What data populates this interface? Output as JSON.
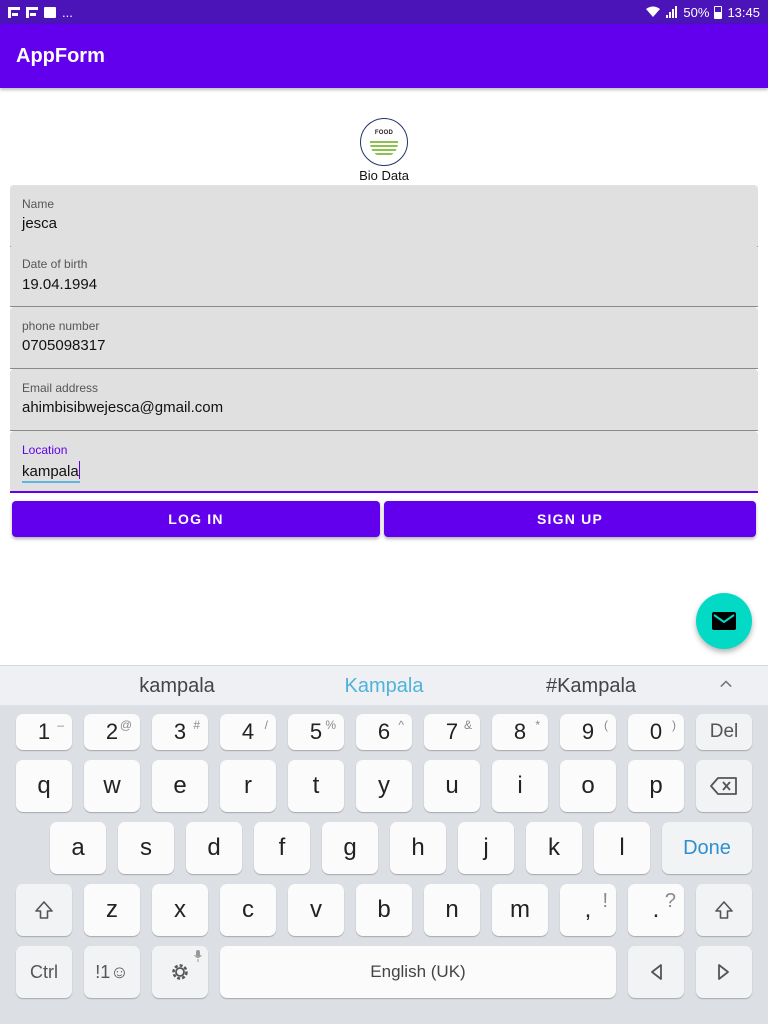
{
  "status_bar": {
    "notif_more": "...",
    "battery_percent": "50%",
    "time": "13:45"
  },
  "appbar": {
    "title": "AppForm"
  },
  "logo": {
    "text": "FOOD"
  },
  "form": {
    "title": "Bio Data",
    "fields": [
      {
        "label": "Name",
        "value": "jesca"
      },
      {
        "label": "Date of birth",
        "value": "19.04.1994"
      },
      {
        "label": "phone number",
        "value": "0705098317"
      },
      {
        "label": "Email address",
        "value": "ahimbisibwejesca@gmail.com"
      },
      {
        "label": "Location",
        "value": "kampala"
      }
    ]
  },
  "buttons": {
    "login": "LOG IN",
    "signup": "SIGN UP"
  },
  "fab": {
    "icon": "email-icon"
  },
  "keyboard": {
    "suggestions": [
      "kampala",
      "Kampala",
      "#Kampala"
    ],
    "number_row": [
      {
        "key": "1",
        "alt": "–"
      },
      {
        "key": "2",
        "alt": "@"
      },
      {
        "key": "3",
        "alt": "#"
      },
      {
        "key": "4",
        "alt": "/"
      },
      {
        "key": "5",
        "alt": "%"
      },
      {
        "key": "6",
        "alt": "^"
      },
      {
        "key": "7",
        "alt": "&"
      },
      {
        "key": "8",
        "alt": "*"
      },
      {
        "key": "9",
        "alt": "("
      },
      {
        "key": "0",
        "alt": ")"
      }
    ],
    "del_label": "Del",
    "row1": [
      "q",
      "w",
      "e",
      "r",
      "t",
      "y",
      "u",
      "i",
      "o",
      "p"
    ],
    "row2": [
      "a",
      "s",
      "d",
      "f",
      "g",
      "h",
      "j",
      "k",
      "l"
    ],
    "done_label": "Done",
    "row3": [
      "z",
      "x",
      "c",
      "v",
      "b",
      "n",
      "m"
    ],
    "comma": {
      "key": ",",
      "alt": "!"
    },
    "period": {
      "key": ".",
      "alt": "?"
    },
    "ctrl_label": "Ctrl",
    "symbols_label": "!1☺",
    "space_label": "English (UK)"
  },
  "colors": {
    "primary": "#6200ee",
    "status_bar": "#4a14b8",
    "accent": "#03dac5",
    "field_bg": "#e0e0e0"
  }
}
